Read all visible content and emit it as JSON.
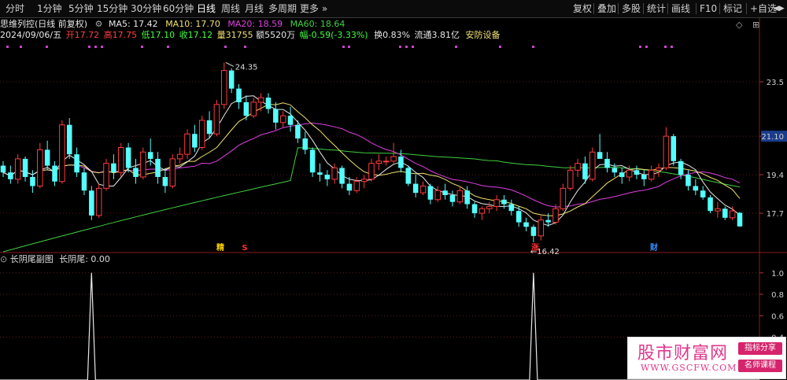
{
  "toolbar": {
    "periods": [
      "分时",
      "1分钟",
      "5分钟",
      "15分钟",
      "30分钟",
      "60分钟",
      "日线",
      "周线",
      "月线",
      "多周期",
      "更多"
    ],
    "active_period": "日线",
    "right": [
      "复权",
      "叠加",
      "多股",
      "统计",
      "画线",
      "F10",
      "标记",
      "+自选",
      "◀",
      "▶"
    ]
  },
  "header": {
    "stock_name": "思维列控(日线 前复权)",
    "ma5": "MA5: 17.42",
    "ma10": "MA10: 17.70",
    "ma20": "MA20: 18.59",
    "ma60": "MA60: 18.64",
    "date": "2024/09/06/五",
    "open": "开17.72",
    "high": "高17.75",
    "low": "低17.10",
    "close": "收17.12",
    "volume": "量31755",
    "amount": "额5520万",
    "change": "幅-0.59(-3.33%)",
    "turnover": "换0.83%",
    "float_cap": "流通3.81亿",
    "sector": "安防设备"
  },
  "price_axis": {
    "labels": [
      "23.5",
      "21.10",
      "19.4",
      "17.7"
    ],
    "current": "21.10"
  },
  "annotations": {
    "high": "24.35",
    "low": "16.42"
  },
  "event_markers": [
    {
      "label": "精",
      "color": "#ffd200"
    },
    {
      "label": "S",
      "color": "#ff3030"
    },
    {
      "label": "涨",
      "color": "#ff3030"
    },
    {
      "label": "财",
      "color": "#3a8dff"
    }
  ],
  "lower": {
    "title": "长阴尾副图",
    "indicator": "长阴尾: 0.00",
    "axis_labels": [
      "1.0",
      "0.8",
      "0.6",
      "0.4"
    ]
  },
  "colors": {
    "up": "#ff3b3b",
    "down": "#54ffff",
    "ma5": "#e8e8e8",
    "ma10": "#f0e070",
    "ma20": "#e040e0",
    "ma60": "#40d040"
  },
  "watermark": {
    "title": "股市财富网",
    "url": "WWW.GSCFW.COM",
    "tag1": "指标分享",
    "tag2": "名师课程"
  },
  "chart_data": {
    "type": "candlestick",
    "ylim": [
      16.0,
      25.2
    ],
    "candles": [
      [
        19.8,
        20.0,
        19.3,
        19.5
      ],
      [
        19.5,
        19.8,
        19.0,
        19.2
      ],
      [
        19.2,
        20.3,
        19.0,
        20.1
      ],
      [
        20.1,
        20.2,
        19.1,
        19.3
      ],
      [
        19.3,
        19.6,
        18.6,
        18.9
      ],
      [
        18.9,
        20.8,
        18.8,
        20.5
      ],
      [
        20.5,
        20.9,
        19.6,
        19.8
      ],
      [
        19.8,
        20.0,
        18.9,
        19.1
      ],
      [
        19.1,
        21.8,
        19.0,
        21.6
      ],
      [
        21.6,
        21.9,
        20.1,
        20.3
      ],
      [
        20.3,
        20.6,
        19.3,
        19.5
      ],
      [
        19.5,
        19.7,
        18.5,
        18.7
      ],
      [
        18.7,
        18.9,
        17.4,
        17.6
      ],
      [
        17.6,
        19.0,
        17.5,
        18.8
      ],
      [
        18.8,
        20.1,
        18.7,
        19.9
      ],
      [
        19.9,
        20.3,
        19.2,
        19.5
      ],
      [
        19.5,
        20.8,
        19.3,
        20.6
      ],
      [
        20.6,
        20.8,
        19.5,
        19.7
      ],
      [
        19.7,
        20.1,
        19.0,
        19.3
      ],
      [
        19.3,
        20.6,
        19.2,
        20.4
      ],
      [
        20.4,
        21.0,
        19.8,
        20.1
      ],
      [
        20.1,
        20.4,
        19.0,
        19.3
      ],
      [
        19.3,
        19.7,
        18.6,
        18.9
      ],
      [
        18.9,
        20.3,
        18.8,
        20.1
      ],
      [
        20.1,
        20.6,
        19.9,
        20.3
      ],
      [
        20.3,
        21.4,
        20.1,
        21.2
      ],
      [
        21.2,
        21.6,
        20.4,
        20.6
      ],
      [
        20.6,
        22.0,
        20.5,
        21.8
      ],
      [
        21.8,
        22.2,
        21.0,
        21.2
      ],
      [
        21.2,
        22.7,
        21.1,
        22.5
      ],
      [
        22.5,
        24.35,
        22.3,
        24.0
      ],
      [
        24.0,
        24.1,
        23.0,
        23.2
      ],
      [
        23.2,
        23.4,
        22.3,
        22.6
      ],
      [
        22.6,
        22.9,
        21.8,
        22.0
      ],
      [
        22.0,
        22.8,
        21.9,
        22.6
      ],
      [
        22.6,
        23.0,
        22.2,
        22.8
      ],
      [
        22.8,
        23.0,
        22.1,
        22.3
      ],
      [
        22.3,
        22.6,
        21.4,
        21.7
      ],
      [
        21.7,
        22.2,
        21.5,
        22.0
      ],
      [
        22.0,
        22.4,
        21.3,
        21.6
      ],
      [
        21.6,
        21.8,
        20.8,
        21.0
      ],
      [
        21.0,
        21.3,
        20.3,
        20.5
      ],
      [
        20.5,
        20.6,
        19.3,
        19.5
      ],
      [
        19.5,
        19.9,
        19.1,
        19.4
      ],
      [
        19.4,
        19.6,
        18.9,
        19.2
      ],
      [
        19.2,
        19.9,
        19.0,
        19.7
      ],
      [
        19.7,
        19.8,
        18.8,
        19.0
      ],
      [
        19.0,
        19.3,
        18.5,
        18.7
      ],
      [
        18.7,
        19.3,
        18.6,
        19.1
      ],
      [
        19.1,
        19.4,
        18.8,
        19.2
      ],
      [
        19.2,
        20.1,
        19.1,
        19.9
      ],
      [
        19.9,
        20.3,
        19.6,
        20.0
      ],
      [
        20.0,
        20.2,
        19.8,
        20.0
      ],
      [
        20.0,
        20.8,
        19.9,
        20.2
      ],
      [
        20.2,
        20.5,
        19.5,
        19.7
      ],
      [
        19.7,
        19.8,
        18.9,
        19.0
      ],
      [
        19.0,
        19.4,
        18.4,
        18.6
      ],
      [
        18.6,
        19.1,
        18.5,
        18.9
      ],
      [
        18.9,
        19.0,
        18.1,
        18.3
      ],
      [
        18.3,
        18.9,
        18.2,
        18.7
      ],
      [
        18.7,
        19.0,
        18.3,
        18.5
      ],
      [
        18.5,
        18.7,
        18.0,
        18.2
      ],
      [
        18.2,
        18.9,
        18.1,
        18.7
      ],
      [
        18.7,
        18.9,
        17.9,
        18.1
      ],
      [
        18.1,
        18.2,
        17.5,
        17.7
      ],
      [
        17.7,
        18.0,
        17.4,
        17.9
      ],
      [
        17.9,
        18.2,
        17.7,
        18.0
      ],
      [
        18.0,
        18.5,
        17.8,
        18.3
      ],
      [
        18.3,
        18.5,
        17.9,
        18.1
      ],
      [
        18.1,
        18.3,
        17.6,
        17.8
      ],
      [
        17.8,
        18.0,
        17.1,
        17.3
      ],
      [
        17.3,
        17.5,
        16.9,
        17.1
      ],
      [
        17.1,
        17.2,
        16.42,
        16.7
      ],
      [
        16.7,
        17.6,
        16.5,
        17.4
      ],
      [
        17.4,
        17.7,
        17.1,
        17.3
      ],
      [
        17.3,
        18.1,
        17.2,
        17.9
      ],
      [
        17.9,
        19.0,
        17.8,
        18.8
      ],
      [
        18.8,
        19.8,
        18.7,
        19.6
      ],
      [
        19.6,
        20.1,
        19.3,
        19.9
      ],
      [
        19.9,
        20.2,
        19.0,
        19.2
      ],
      [
        19.2,
        20.6,
        19.1,
        20.4
      ],
      [
        20.4,
        21.2,
        20.2,
        20.1
      ],
      [
        20.1,
        20.4,
        19.5,
        19.7
      ],
      [
        19.7,
        19.9,
        19.3,
        19.5
      ],
      [
        19.5,
        19.7,
        19.0,
        19.3
      ],
      [
        19.3,
        19.8,
        19.1,
        19.6
      ],
      [
        19.6,
        19.8,
        19.2,
        19.4
      ],
      [
        19.4,
        19.6,
        18.9,
        19.2
      ],
      [
        19.2,
        19.8,
        19.1,
        19.6
      ],
      [
        19.6,
        19.9,
        19.3,
        19.7
      ],
      [
        19.7,
        21.5,
        19.6,
        21.1
      ],
      [
        21.1,
        21.2,
        19.8,
        20.0
      ],
      [
        20.0,
        20.1,
        19.2,
        19.4
      ],
      [
        19.4,
        19.6,
        18.7,
        18.9
      ],
      [
        18.9,
        19.2,
        18.5,
        18.7
      ],
      [
        18.7,
        18.9,
        18.3,
        18.4
      ],
      [
        18.4,
        18.5,
        17.7,
        17.8
      ],
      [
        17.8,
        18.2,
        17.5,
        17.9
      ],
      [
        17.9,
        18.0,
        17.4,
        17.5
      ],
      [
        17.5,
        18.0,
        17.4,
        17.8
      ],
      [
        17.72,
        17.75,
        17.1,
        17.12
      ]
    ],
    "series": [
      {
        "name": "MA5",
        "values": [
          17.42
        ]
      },
      {
        "name": "MA10",
        "values": [
          17.7
        ]
      },
      {
        "name": "MA20",
        "values": [
          18.59
        ]
      },
      {
        "name": "MA60",
        "values": [
          18.64
        ]
      }
    ],
    "indicator": {
      "name": "长阴尾",
      "spikes": [
        {
          "candle_index": 12,
          "value": 1.0
        },
        {
          "candle_index": 72,
          "value": 1.0
        }
      ],
      "ylim": [
        0,
        1.05
      ]
    }
  }
}
